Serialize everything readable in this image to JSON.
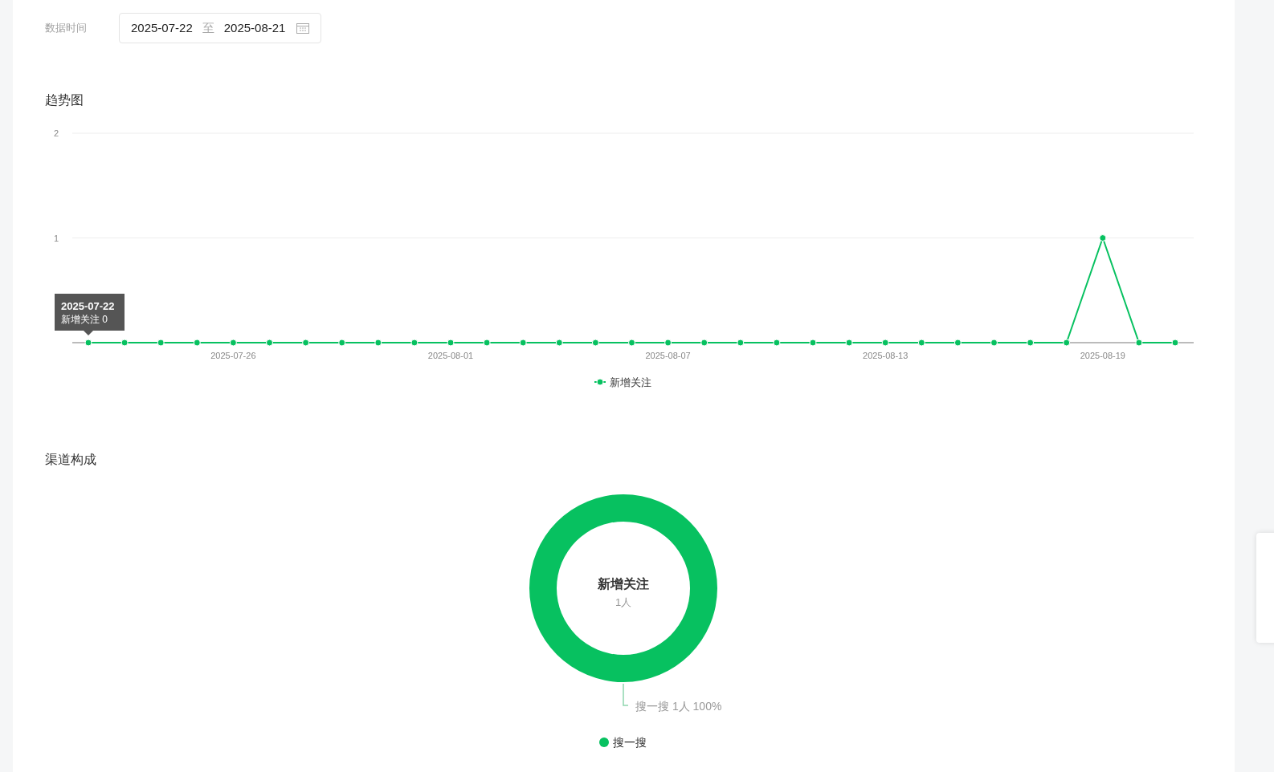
{
  "filter": {
    "label": "数据时间",
    "start": "2025-07-22",
    "separator": "至",
    "end": "2025-08-21"
  },
  "trend": {
    "title": "趋势图",
    "tooltip": {
      "title": "2025-07-22",
      "text": "新增关注 0"
    },
    "chart_data": {
      "type": "line",
      "categories": [
        null,
        null,
        null,
        null,
        "2025-07-26",
        null,
        null,
        null,
        null,
        null,
        "2025-08-01",
        null,
        null,
        null,
        null,
        null,
        "2025-08-07",
        null,
        null,
        null,
        null,
        null,
        "2025-08-13",
        null,
        null,
        null,
        null,
        null,
        "2025-08-19",
        null,
        null
      ],
      "series": [
        {
          "name": "新增关注",
          "color": "#07c160",
          "marker": "circle",
          "values": [
            0,
            0,
            0,
            0,
            0,
            0,
            0,
            0,
            0,
            0,
            0,
            0,
            0,
            0,
            0,
            0,
            0,
            0,
            0,
            0,
            0,
            0,
            0,
            0,
            0,
            0,
            0,
            0,
            1,
            0,
            0
          ]
        }
      ],
      "ylim": [
        0,
        2
      ],
      "yticks": [
        1,
        2
      ]
    }
  },
  "channels": {
    "title": "渠道构成",
    "center_title": "新增关注",
    "center_value": "1人",
    "slices": [
      {
        "name": "搜一搜",
        "label": "搜一搜 1人 100%",
        "color": "#07c160"
      }
    ]
  }
}
